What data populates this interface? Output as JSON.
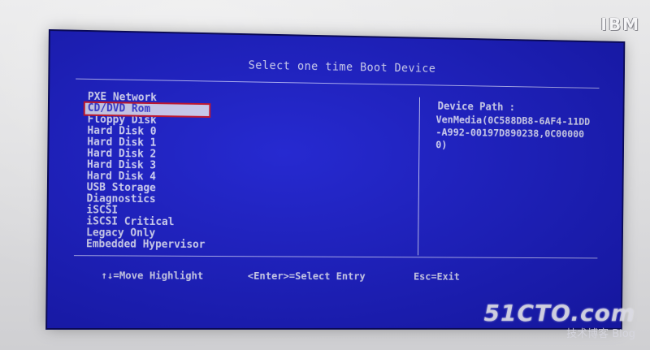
{
  "brand": "IBM",
  "screen": {
    "title": "Select one time Boot Device",
    "boot_devices": [
      "PXE Network",
      "CD/DVD Rom",
      "Floppy Disk",
      "Hard Disk 0",
      "Hard Disk 1",
      "Hard Disk 2",
      "Hard Disk 3",
      "Hard Disk 4",
      "USB Storage",
      "Diagnostics",
      "iSCSI",
      "iSCSI Critical",
      "Legacy Only",
      "Embedded Hypervisor"
    ],
    "selected_device": "CD/DVD Rom",
    "device_path_label": "Device Path :",
    "device_path_value": "VenMedia(0C588DB8-6AF4-11DD-A992-00197D890238,0C000000)",
    "footer": {
      "move": "↑↓=Move Highlight",
      "select": "<Enter>=Select Entry",
      "exit": "Esc=Exit"
    }
  },
  "watermark": {
    "logo": "51CTO.com",
    "subtitle": "技术博客 Blog"
  },
  "colors": {
    "screen_bg": "#1d1fc6",
    "text": "#f2f2ff",
    "highlight_box": "#e01010"
  }
}
